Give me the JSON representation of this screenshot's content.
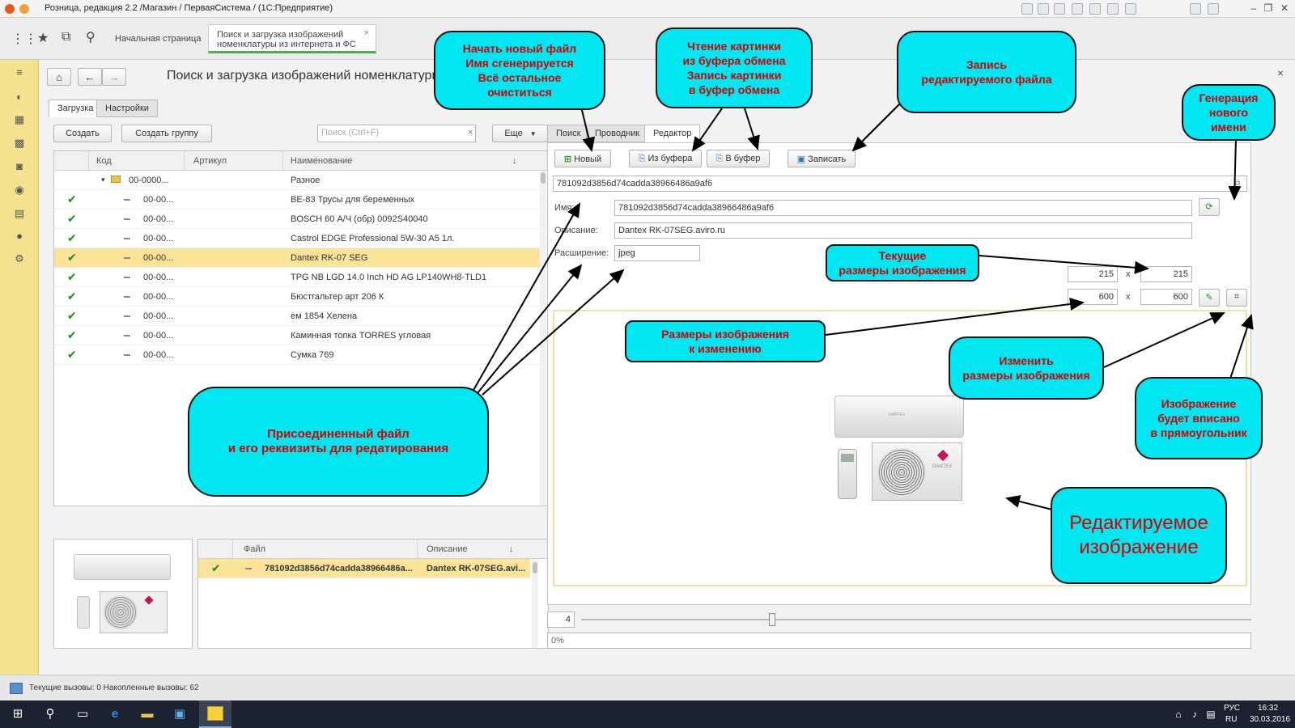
{
  "window": {
    "title": "Розница, редакция 2.2 /Магазин / ПерваяСистема /  (1С:Предприятие)"
  },
  "tabs": {
    "home": "Начальная страница",
    "active": "Поиск и загрузка изображений\nноменклатуры из интернета и ФС",
    "close": "×"
  },
  "form": {
    "title": "Поиск и загрузка изображений номенклатуры",
    "close": "×",
    "left_tabs": [
      "Загрузка",
      "Настройки"
    ],
    "create_label": "Создать",
    "create_group_label": "Создать группу",
    "search_placeholder": "Поиск (Ctrl+F)",
    "search_clear": "×",
    "more_label": "Еще",
    "columns": [
      "Код",
      "Артикул",
      "Наименование"
    ],
    "sort_icon": "↓",
    "group_row": {
      "code": "00-0000...",
      "name": "Разное"
    },
    "rows": [
      {
        "code": "00-00...",
        "name": "BE-83 Трусы для беременных"
      },
      {
        "code": "00-00...",
        "name": "BOSCH 60 А/Ч (обр) 0092S40040"
      },
      {
        "code": "00-00...",
        "name": "Castrol EDGE Professional 5W-30 A5 1л."
      },
      {
        "code": "00-00...",
        "name": "Dantex RK-07 SEG"
      },
      {
        "code": "00-00...",
        "name": "TPG NB LGD 14.0 Inch HD AG LP140WH8-TLD1"
      },
      {
        "code": "00-00...",
        "name": "Бюстгальтер арт 206 К"
      },
      {
        "code": "00-00...",
        "name": "ем 1854 Хелена"
      },
      {
        "code": "00-00...",
        "name": "Каминная топка TORRES угловая"
      },
      {
        "code": "00-00...",
        "name": "Сумка 769"
      }
    ],
    "files_columns": [
      "Файл",
      "Описание"
    ],
    "files_row": {
      "file": "781092d3856d74cadda38966486a...",
      "desc": "Dantex RK-07SEG.avi..."
    }
  },
  "right": {
    "tabs": [
      "Поиск",
      "Проводник",
      "Редактор"
    ],
    "btn_new": "Новый",
    "btn_from_buffer": "Из буфера",
    "btn_to_buffer": "В буфер",
    "btn_save": "Записать",
    "path": "781092d3856d74cadda38966486a9af6",
    "name_label": "Имя:",
    "name_value": "781092d3856d74cadda38966486a9af6",
    "desc_label": "Описание:",
    "desc_value": "Dantex RK-07SEG.aviro.ru",
    "ext_label": "Расширение:",
    "ext_value": "jpeg",
    "cur_w": "215",
    "cur_h": "215",
    "new_w": "600",
    "new_h": "600",
    "times": "x",
    "zoom_value": "4",
    "progress_text": "0%"
  },
  "callouts": {
    "new_file": "Начать новый файл\nИмя сгенерируется\nВсё остальное\nочиститься",
    "buffer": "Чтение картинки\nиз буфера обмена\nЗапись картинки\nв буфер обмена",
    "save": "Запись\nредактируемого файла",
    "gen_name": "Генерация\nнового\nимени",
    "cur_size": "Текущие\nразмеры изображения",
    "resize_size": "Размеры изображения\nк изменению",
    "change_size": "Изменить\nразмеры изображения",
    "fit": "Изображение\nбудет вписано\nв прямоугольник",
    "attached": "Присоединенный файл\nи его реквизиты для редатирования",
    "edited": "Редактируемое\nизображение"
  },
  "brand": {
    "dantex": "DANTEX"
  },
  "status": {
    "text": "Текущие вызовы: 0   Накопленные вызовы: 62"
  },
  "taskbar": {
    "lang": "РУС",
    "lang2": "RU",
    "time": "16:32",
    "date": "30.03.2016"
  },
  "colors": {
    "accent": "#4caf50",
    "sidebar": "#f5e28e",
    "selected_row": "#fbe39a",
    "callout_bg": "#00e7f1",
    "callout_text": "#d40000"
  }
}
